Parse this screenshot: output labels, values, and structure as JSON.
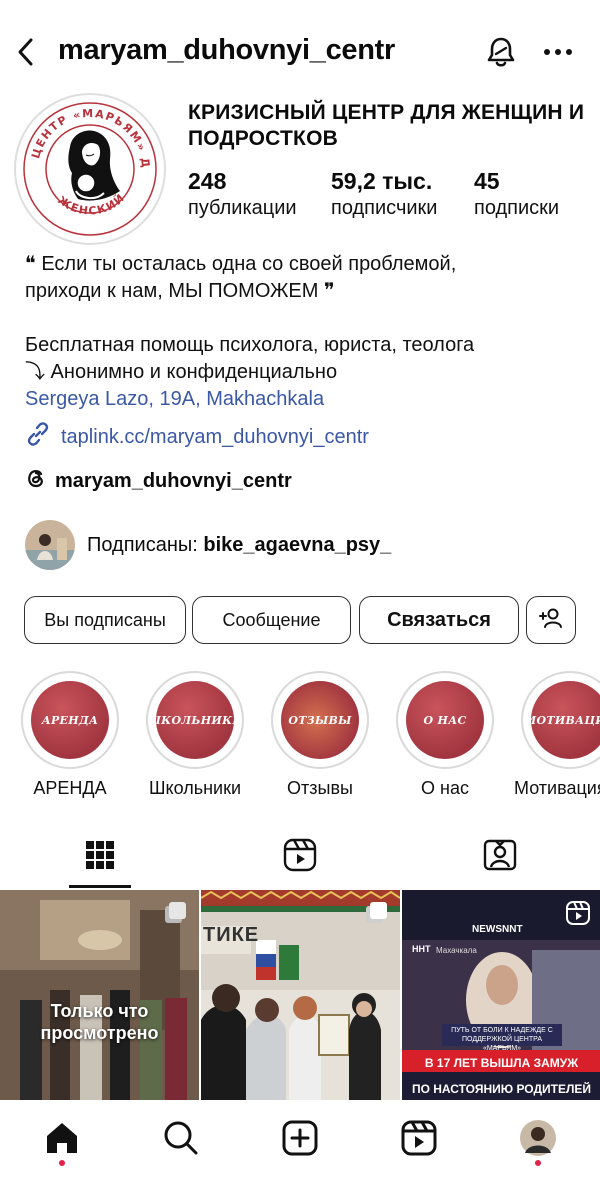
{
  "header": {
    "username": "maryam_duhovnyi_centr"
  },
  "profile": {
    "display_name": "КРИЗИСНЫЙ ЦЕНТР ДЛЯ ЖЕНЩИН И ПОДРОСТКОВ",
    "avatar_text": "ЦЕНТР «МАРЬЯМ» ДУХОВНЫЙ ЖЕНСКИЙ",
    "stats": [
      {
        "value": "248",
        "label": "публикации"
      },
      {
        "value": "59,2 тыс.",
        "label": "подписчики"
      },
      {
        "value": "45",
        "label": "подписки"
      }
    ]
  },
  "bio": {
    "line1": "❝ Если ты осталась одна со своей проблемой,",
    "line2": "приходи к нам, МЫ ПОМОЖЕМ ❞",
    "line3": "Бесплатная помощь психолога, юриста, теолога",
    "line4": "⤵ Анонимно и конфиденциально",
    "address": "Sergeya Lazo, 19A, Makhachkala",
    "link": "taplink.cc/maryam_duhovnyi_centr",
    "threads": "maryam_duhovnyi_centr"
  },
  "followed_by": {
    "prefix": "Подписаны: ",
    "user": "bike_agaevna_psy_"
  },
  "buttons": {
    "following": "Вы подписаны",
    "message": "Сообщение",
    "contact": "Связаться"
  },
  "highlights": [
    {
      "cover": "АРЕНДА",
      "label": "АРЕНДА"
    },
    {
      "cover": "ШКОЛЬНИКИ",
      "label": "Школьники"
    },
    {
      "cover": "ОТЗЫВЫ",
      "label": "Отзывы"
    },
    {
      "cover": "О НАС",
      "label": "О нас"
    },
    {
      "cover": "МОТИВАЦИЯ",
      "label": "Мотивация"
    }
  ],
  "posts": {
    "p1_overlay": "Только что просмотрено",
    "p2_sign": "ТИКЕ",
    "p3_channel": "NEWSNNT",
    "p3_small": "ПУТЬ ОТ БОЛИ К НАДЕЖДЕ С ПОДДЕРЖКОЙ ЦЕНТРА «МАРЬЯМ»",
    "p3_headline1": "В 17 ЛЕТ ВЫШЛА ЗАМУЖ",
    "p3_headline2": "ПО НАСТОЯНИЮ РОДИТЕЛЕЙ",
    "p3_logo": "ННТ",
    "p3_city": "Махачкала"
  },
  "colors": {
    "link": "#3a58a6",
    "highlight": "#a23640",
    "notification_dot": "#e0244b"
  },
  "icons": [
    "back-arrow-icon",
    "bell-icon",
    "more-dots-icon",
    "link-icon",
    "threads-icon",
    "add-person-icon",
    "grid-icon",
    "reels-icon",
    "tagged-icon",
    "home-icon",
    "search-icon",
    "create-icon",
    "profile-avatar"
  ]
}
